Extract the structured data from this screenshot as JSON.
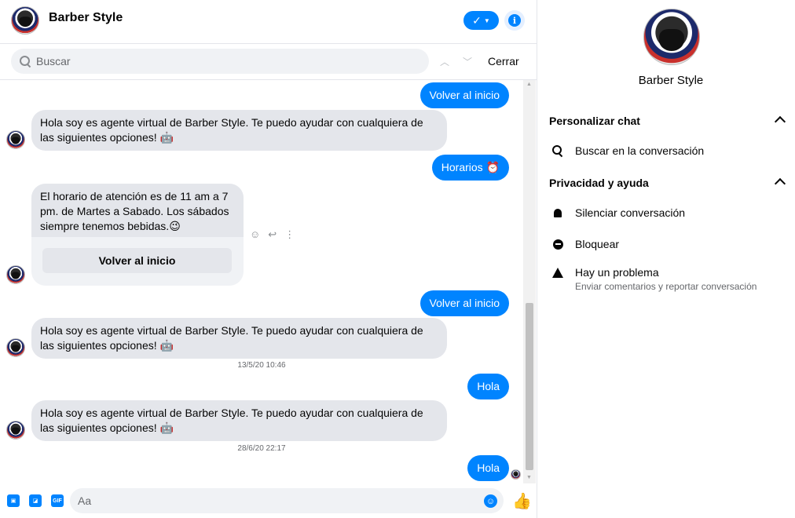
{
  "header": {
    "title": "Barber Style",
    "avatar_icon": "barber-shop-logo"
  },
  "search": {
    "placeholder": "Buscar",
    "close_label": "Cerrar",
    "up_icon": "chevron-up-icon",
    "down_icon": "chevron-down-icon"
  },
  "messages": [
    {
      "id": "m1",
      "side": "out",
      "text": "Volver al inicio"
    },
    {
      "id": "m2",
      "side": "in",
      "text": "Hola soy es agente virtual de Barber Style. Te puedo ayudar con cualquiera de las siguientes opciones! 🤖"
    },
    {
      "id": "m3",
      "side": "out",
      "text": "Horarios ⏰"
    },
    {
      "id": "m4",
      "side": "in",
      "text": "El horario de atención es de 11 am a 7 pm. de Martes a Sabado. Los sábados siempre tenemos bebidas.😉",
      "button": "Volver al inicio"
    },
    {
      "id": "m5",
      "side": "out",
      "text": "Volver al inicio"
    },
    {
      "id": "m6",
      "side": "in",
      "text": "Hola soy es agente virtual de Barber Style. Te puedo ayudar con cualquiera de las siguientes opciones! 🤖"
    },
    {
      "id": "t1",
      "side": "time",
      "text": "13/5/20 10:46"
    },
    {
      "id": "m7",
      "side": "out",
      "text": "Hola"
    },
    {
      "id": "m8",
      "side": "in",
      "text": "Hola soy es agente virtual de Barber Style. Te puedo ayudar con cualquiera de las siguientes opciones! 🤖"
    },
    {
      "id": "t2",
      "side": "time",
      "text": "28/6/20 22:17"
    },
    {
      "id": "m9",
      "side": "out",
      "text": "Hola"
    }
  ],
  "composer": {
    "placeholder": "Aa",
    "gif_label": "GIF"
  },
  "info": {
    "name": "Barber Style",
    "sections": [
      {
        "title": "Personalizar chat",
        "items": [
          {
            "label": "Buscar en la conversación",
            "icon": "search-icon"
          }
        ]
      },
      {
        "title": "Privacidad y ayuda",
        "items": [
          {
            "label": "Silenciar conversación",
            "icon": "bell-icon"
          },
          {
            "label": "Bloquear",
            "icon": "block-icon"
          },
          {
            "label": "Hay un problema",
            "sub": "Enviar comentarios y reportar conversación",
            "icon": "warning-icon"
          }
        ]
      }
    ]
  },
  "colors": {
    "accent": "#0084ff",
    "bubble_in": "#e4e6eb",
    "text": "#050505",
    "muted": "#65676b"
  }
}
